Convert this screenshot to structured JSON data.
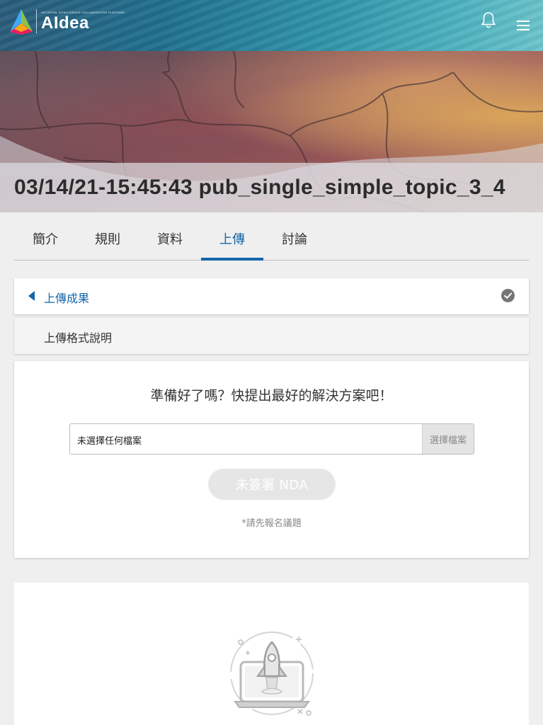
{
  "header": {
    "logo_small_text": "ARTIFICIAL INTELLIGENCE COLLABORATION PLATFORM",
    "logo_name": "AIdea",
    "colors": {
      "brand_teal": "#2f93a8",
      "brand_dark": "#2a5c7a"
    },
    "icons": [
      "bell-icon",
      "hamburger-menu-icon"
    ]
  },
  "hero": {
    "title": "03/14/21-15:45:43 pub_single_simple_topic_3_4"
  },
  "tabs": [
    {
      "label": "簡介",
      "active": false
    },
    {
      "label": "規則",
      "active": false
    },
    {
      "label": "資料",
      "active": false
    },
    {
      "label": "上傳",
      "active": true
    },
    {
      "label": "討論",
      "active": false
    }
  ],
  "accordion": {
    "results_label": "上傳成果",
    "format_label": "上傳格式說明"
  },
  "upload": {
    "prompt": "準備好了嗎？快提出最好的解決方案吧！",
    "file_placeholder": "未選擇任何檔案",
    "choose_file_label": "選擇檔案",
    "nda_button_label": "未簽署 NDA",
    "note": "*請先報名議題"
  },
  "accent_color": "#1565a8"
}
